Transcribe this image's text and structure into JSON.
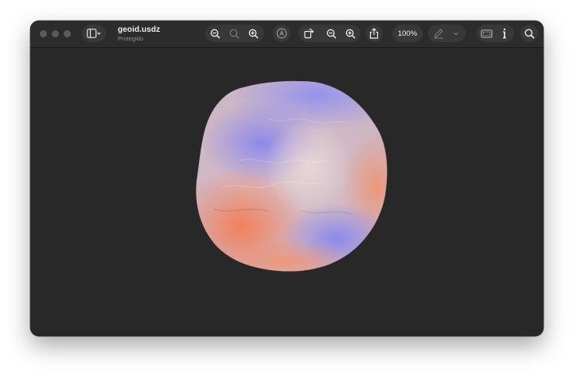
{
  "window": {
    "title": "geoid.usdz",
    "subtitle": "Protegido"
  },
  "toolbar": {
    "zoom_level": "100%"
  },
  "icons": {
    "sidebar_toggle": "sidebar-icon",
    "zoom_out": "zoom-out-icon",
    "zoom_actual": "zoom-actual-icon",
    "zoom_in": "zoom-in-icon",
    "markup": "markup-icon",
    "rotate": "rotate-icon",
    "share": "share-icon",
    "highlight": "pen-icon",
    "crop": "crop-icon",
    "info": "info-icon",
    "search": "search-icon"
  },
  "colors": {
    "window_bg": "#282828",
    "toolbar_bg": "#2c2c2c",
    "control_bg": "#383838",
    "model_warm": "#f08c6e",
    "model_cool": "#9a92e8"
  }
}
